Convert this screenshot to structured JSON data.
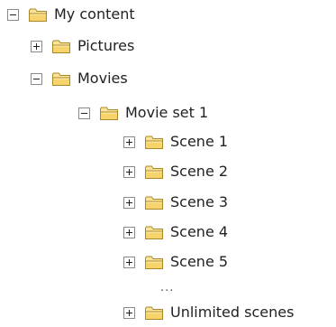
{
  "tree": {
    "root": {
      "label": "My content",
      "expanded": true
    },
    "pictures": {
      "label": "Pictures",
      "expanded": false
    },
    "movies": {
      "label": "Movies",
      "expanded": true
    },
    "movie_set_1": {
      "label": "Movie set 1",
      "expanded": true
    },
    "scenes": [
      {
        "label": "Scene 1",
        "expanded": false
      },
      {
        "label": "Scene 2",
        "expanded": false
      },
      {
        "label": "Scene 3",
        "expanded": false
      },
      {
        "label": "Scene 4",
        "expanded": false
      },
      {
        "label": "Scene 5",
        "expanded": false
      }
    ],
    "ellipsis": "...",
    "unlimited": {
      "label": "Unlimited scenes",
      "expanded": false
    }
  },
  "icons": {
    "folder": "folder-icon",
    "expand": "expand-icon",
    "collapse": "collapse-icon"
  },
  "colors": {
    "folder_fill": "#f7d36b",
    "folder_stroke": "#a88926",
    "toggle_border": "#8a8a8a"
  }
}
